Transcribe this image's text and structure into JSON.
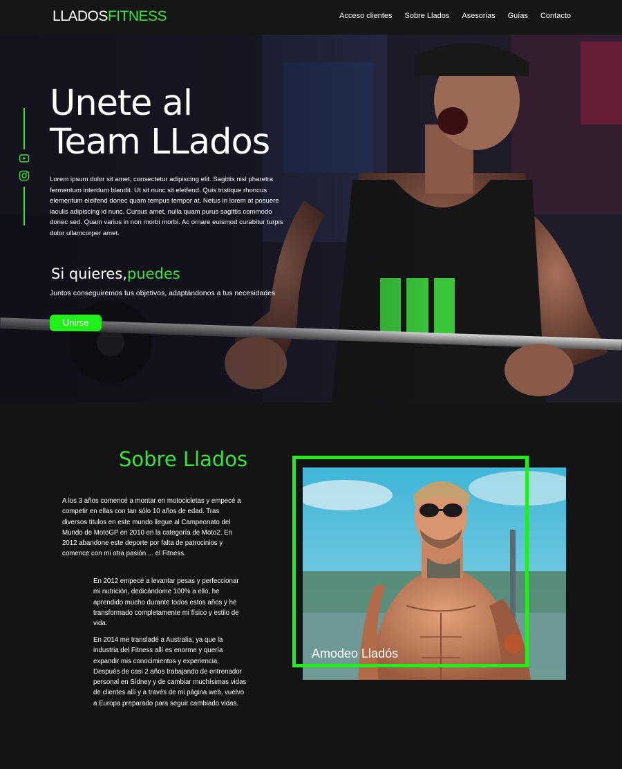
{
  "nav": {
    "logo_part1": "LLADOS",
    "logo_part2": "FITNESS",
    "items": [
      "Acceso clientes",
      "Sobre Llados",
      "Asesorias",
      "Guías",
      "Contacto"
    ]
  },
  "hero": {
    "title_line1": "Unete al",
    "title_line2": "Team LLados",
    "text": "Lorem ipsum dolor sit amet, consectetur adipiscing elit. Sagittis nisl pharetra fermentum interdum blandit. Ut sit nunc sit eleifend. Quis tristique rhoncus elementum eleifend donec quam tempus tempor at. Netus in lorem at posuere iaculis adipiscing id nunc. Cursus amet, nulla quam purus sagittis commodo donec sed. Quam varius in non morbi morbi. Ac ornare euismod curabitur turpis dolor ullamcorper amet.",
    "slogan_part1": "Si quieres,",
    "slogan_part2": "puedes",
    "slogan_sub": "Juntos conseguiremos tus objetivos, adaptándonos a tus necesidades",
    "join_button": "Unirse"
  },
  "social": {
    "icons": [
      "youtube-icon",
      "instagram-icon"
    ]
  },
  "about": {
    "title": "Sobre Llados",
    "p1": "A los 3 años comencé a montar en motocicletas y empecé a competir en ellas con tan sólo 10 años de edad. Tras diversos titulos en este mundo llegue al Campeonato del Mundo de MotoGP en 2010 en la categoría de Moto2. En 2012 abandone este deporte por falta de patrocinios y comence con mi otra pasión ... el Fitness.",
    "p2": "En 2012 empecé a levantar pesas y perfeccionar mi nutrición, dedicándome 100% a ello, he aprendido mucho durante todos estos años y he transformado completamente mi físico y estilo de vida.",
    "p3": "En 2014 me transladé a Australia, ya que la industria del Fitness allí es enorme y quería expandir mis conocimientos y experiencia. Después de casi 2 años trabajando de entrenador personal en Sídney y de cambiar muchísimas vidas de clientes allí y a través de mi página web, vuelvo a Europa preparado para seguir cambiado vidas.",
    "photo_caption": "Amodeo Lladós"
  },
  "colors": {
    "accent": "#39e53a",
    "button": "#1ff019",
    "background": "#141414"
  }
}
